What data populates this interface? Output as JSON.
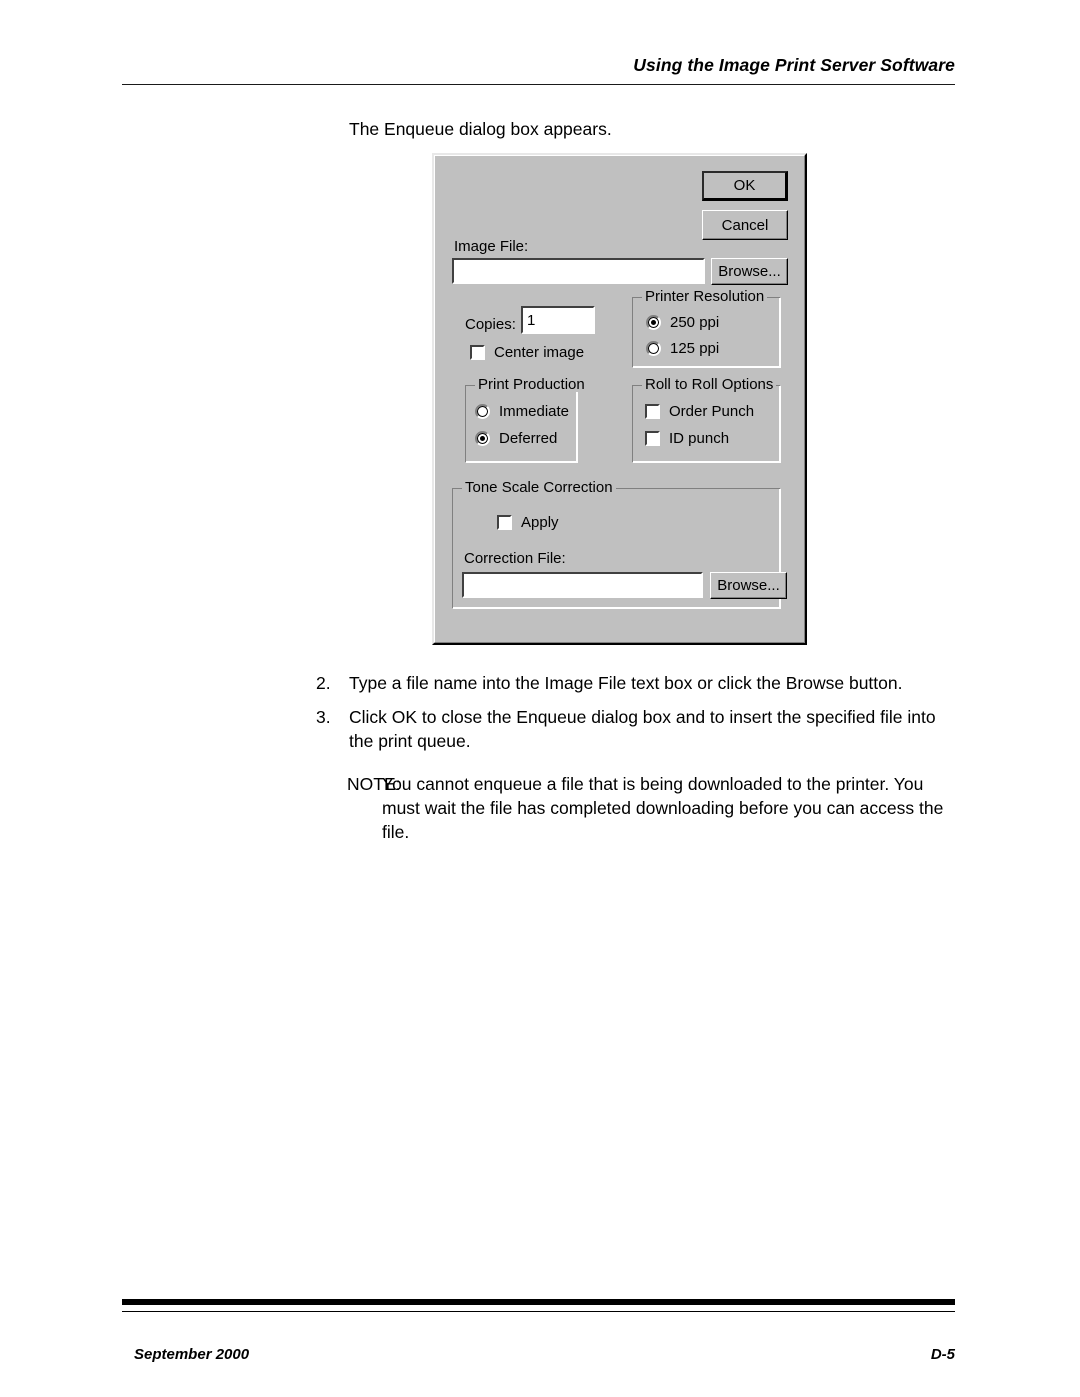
{
  "page": {
    "header_title": "Using the Image Print Server Software",
    "intro_line": "The Enqueue dialog box appears.",
    "footer_left": "September 2000",
    "footer_right": "D-5"
  },
  "dialog": {
    "buttons": {
      "ok": "OK",
      "cancel": "Cancel",
      "browse_image": "Browse...",
      "browse_correction": "Browse..."
    },
    "image_file": {
      "label": "Image File:",
      "value": ""
    },
    "copies": {
      "label": "Copies:",
      "value": "1"
    },
    "center_image": {
      "label": "Center image",
      "checked": false
    },
    "printer_resolution": {
      "title": "Printer Resolution",
      "options": [
        {
          "label": "250 ppi",
          "selected": true
        },
        {
          "label": "125 ppi",
          "selected": false
        }
      ]
    },
    "print_production": {
      "title": "Print Production",
      "options": [
        {
          "label": "Immediate",
          "selected": false
        },
        {
          "label": "Deferred",
          "selected": true
        }
      ]
    },
    "roll_to_roll": {
      "title": "Roll to Roll Options",
      "options": [
        {
          "label": "Order Punch",
          "checked": false
        },
        {
          "label": "ID punch",
          "checked": false
        }
      ]
    },
    "tone_scale": {
      "title": "Tone Scale Correction",
      "apply": {
        "label": "Apply",
        "checked": false
      },
      "correction_file": {
        "label": "Correction File:",
        "value": ""
      }
    }
  },
  "steps": [
    {
      "num": "2.",
      "text": "Type a file name into the Image File text box or click the Browse button."
    },
    {
      "num": "3.",
      "text": "Click OK to close the Enqueue dialog box and to insert the specified file into the print queue."
    }
  ],
  "note": {
    "label": "NOTE:",
    "text": "You cannot enqueue a file that is being downloaded to the printer. You must wait the file has completed downloading before you can access the file."
  }
}
